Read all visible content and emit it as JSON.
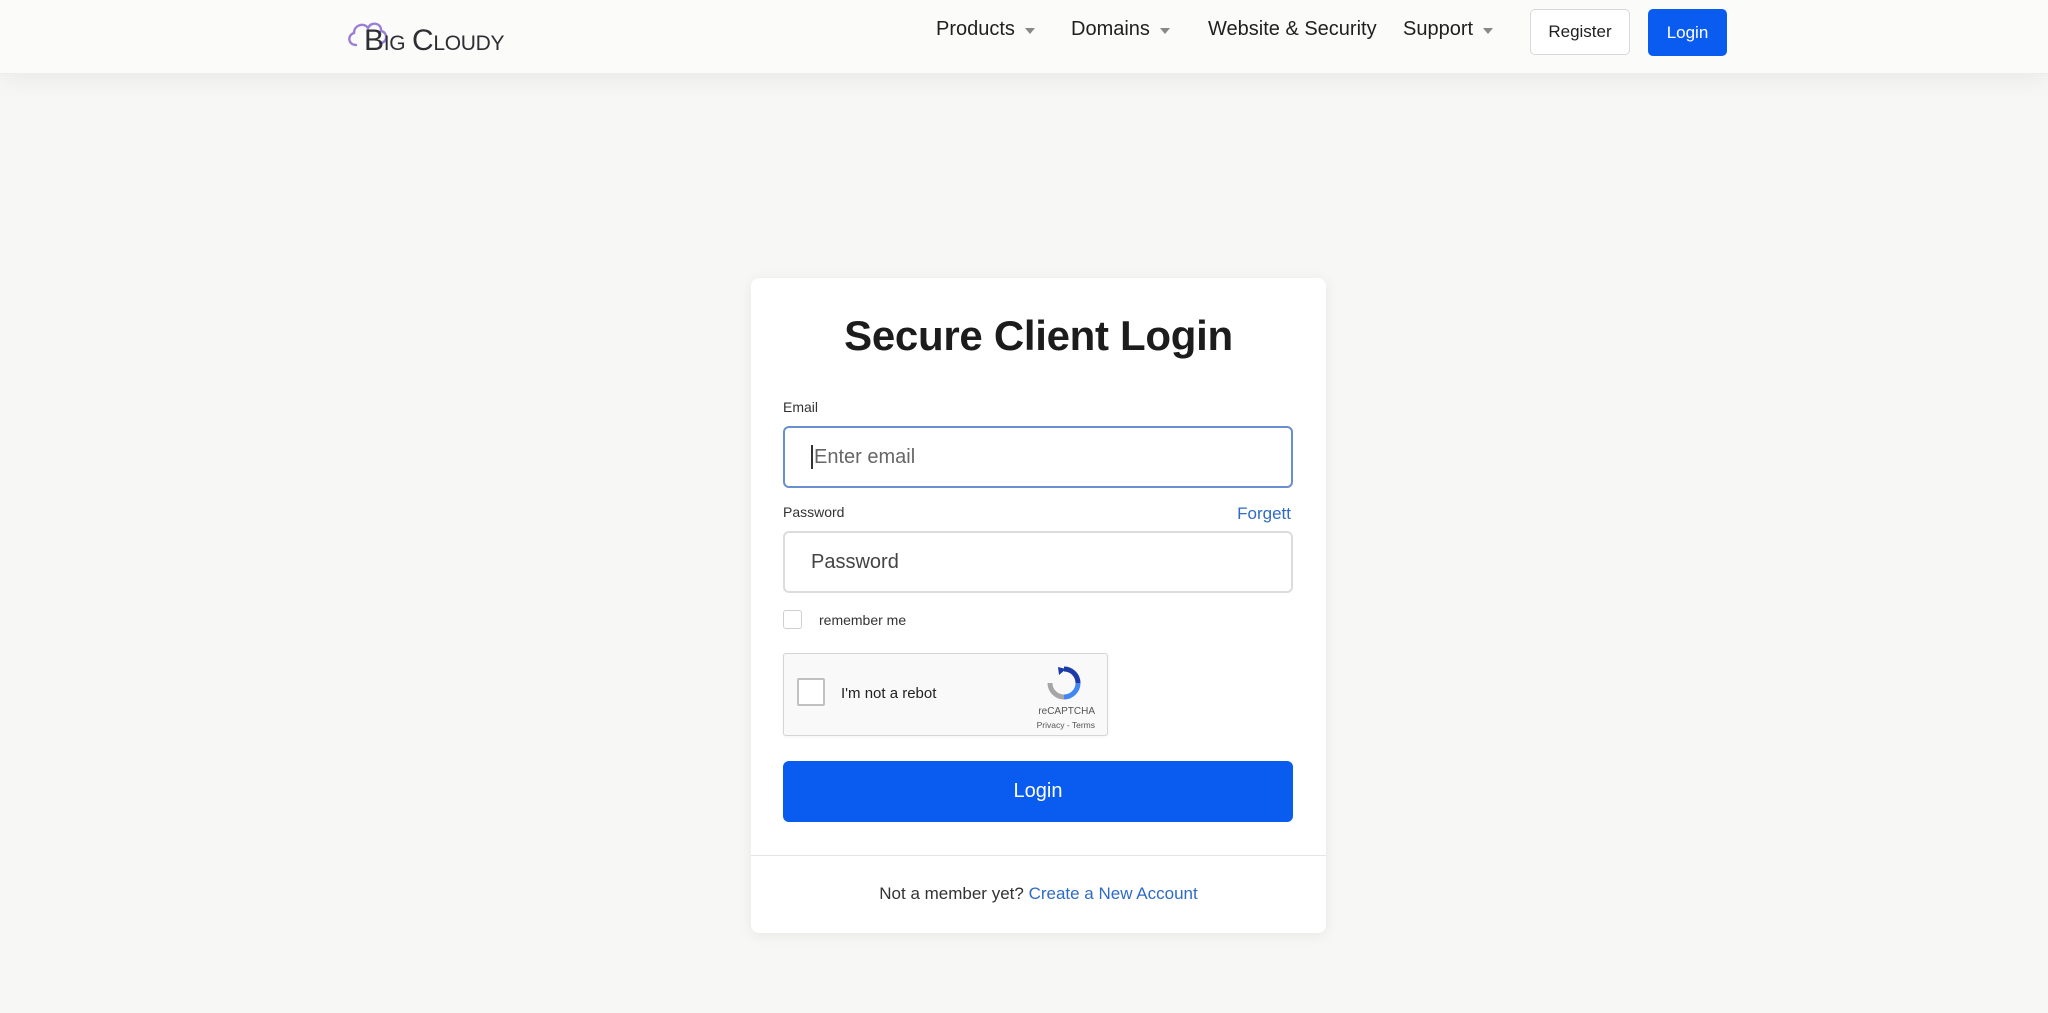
{
  "header": {
    "logo": {
      "big_first": "B",
      "rest_first": "IG",
      "big_second": "C",
      "rest_second": "LOUDY"
    },
    "nav": [
      {
        "label": "Products",
        "has_dropdown": true
      },
      {
        "label": "Domains",
        "has_dropdown": true
      },
      {
        "label": "Website & Security",
        "has_dropdown": false
      },
      {
        "label": "Support",
        "has_dropdown": true
      }
    ],
    "register_label": "Register",
    "login_label": "Login"
  },
  "login_card": {
    "title": "Secure Client Login",
    "email_label": "Email",
    "email_placeholder": "Enter email",
    "password_label": "Password",
    "forgot_label": "Forgett",
    "password_placeholder": "Password",
    "remember_label": "remember me",
    "remember_checked": false,
    "recaptcha": {
      "text": "I'm not a rebot",
      "brand": "reCAPTCHA",
      "links": "Privacy - Terms",
      "checked": false
    },
    "login_button": "Login",
    "footer_text": "Not a member yet?",
    "footer_link": "Create a New Account"
  },
  "colors": {
    "primary": "#0a5cf0",
    "link": "#2f6bc4",
    "background": "#f7f7f6",
    "logo_cloud": "#9b7fd6"
  }
}
